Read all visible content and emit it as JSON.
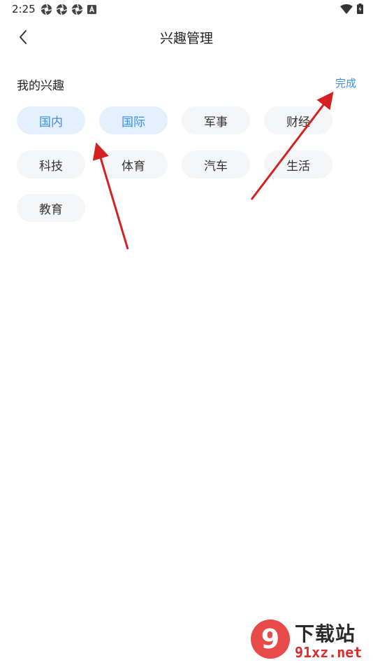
{
  "status_bar": {
    "time": "2:25",
    "left_icons": [
      "aperture-icon",
      "aperture-icon",
      "aperture-icon",
      "a-square-icon"
    ],
    "right_icons": [
      "wifi-icon",
      "battery-icon"
    ]
  },
  "nav": {
    "title": "兴趣管理",
    "back_icon": "chevron-left-icon"
  },
  "section": {
    "title": "我的兴趣",
    "done_label": "完成"
  },
  "tags": [
    {
      "label": "国内",
      "selected": true
    },
    {
      "label": "国际",
      "selected": true
    },
    {
      "label": "军事",
      "selected": false
    },
    {
      "label": "财经",
      "selected": false
    },
    {
      "label": "科技",
      "selected": false
    },
    {
      "label": "体育",
      "selected": false
    },
    {
      "label": "汽车",
      "selected": false
    },
    {
      "label": "生活",
      "selected": false
    },
    {
      "label": "教育",
      "selected": false
    }
  ],
  "watermark": {
    "logo_text": "9",
    "top_text": "下载站",
    "bottom_text": "91xz.net"
  },
  "colors": {
    "accent": "#3a8ee6",
    "selected_bg": "#e4f1fd",
    "tag_bg": "#f5f6f8",
    "arrow": "#d42020"
  }
}
